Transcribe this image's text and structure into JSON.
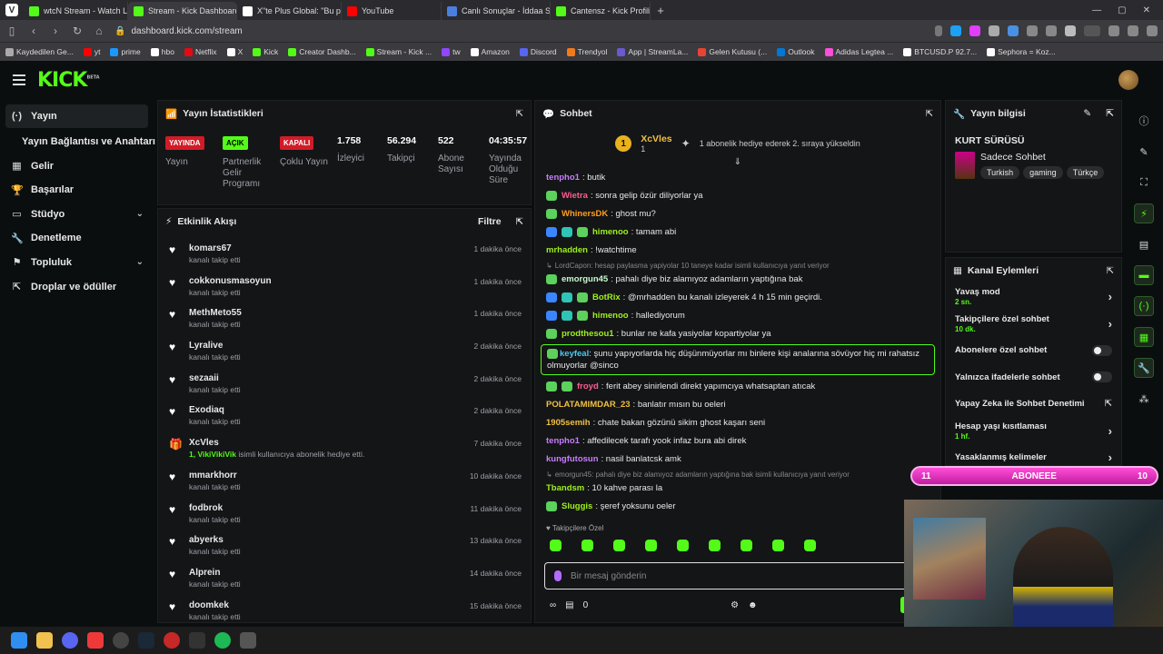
{
  "browser": {
    "tabs": [
      {
        "title": "wtcN Stream - Watch Live o",
        "color": "#53fc18"
      },
      {
        "title": "Stream - Kick Dashboard",
        "color": "#53fc18"
      },
      {
        "title": "X\"te Plus Global: \"Bu pozisy",
        "color": "#ffffff"
      },
      {
        "title": "YouTube",
        "color": "#ff0000"
      },
      {
        "title": "Canlı Sonuçlar - İddaa Son",
        "color": "#4a7fe0"
      },
      {
        "title": "Cantensz - Kick Profili",
        "color": "#53fc18"
      }
    ],
    "url": "dashboard.kick.com/stream",
    "bookmarks": [
      {
        "label": "Kaydedilen Ge...",
        "color": "#aaaaaa"
      },
      {
        "label": "yt",
        "color": "#ff0000"
      },
      {
        "label": "prime",
        "color": "#1a98ff"
      },
      {
        "label": "hbo",
        "color": "#ffffff"
      },
      {
        "label": "Netflix",
        "color": "#e50914"
      },
      {
        "label": "X",
        "color": "#ffffff"
      },
      {
        "label": "Kick",
        "color": "#53fc18"
      },
      {
        "label": "Creator Dashb...",
        "color": "#53fc18"
      },
      {
        "label": "Stream - Kick ...",
        "color": "#53fc18"
      },
      {
        "label": "tw",
        "color": "#9146ff"
      },
      {
        "label": "Amazon",
        "color": "#ffffff"
      },
      {
        "label": "Discord",
        "color": "#5865f2"
      },
      {
        "label": "Trendyol",
        "color": "#f27a1a"
      },
      {
        "label": "App | StreamLa...",
        "color": "#6a5acd"
      },
      {
        "label": "Gelen Kutusu (...",
        "color": "#ea4335"
      },
      {
        "label": "Outlook",
        "color": "#0078d4"
      },
      {
        "label": "Adidas Legtea ...",
        "color": "#ff4ed8"
      },
      {
        "label": "BTCUSD.P 92.7...",
        "color": "#ffffff"
      },
      {
        "label": "Sephora = Koz...",
        "color": "#ffffff"
      }
    ]
  },
  "sidebar": {
    "items": [
      {
        "label": "Yayın",
        "icon": "(·)"
      },
      {
        "label": "Yayın Bağlantısı ve Anahtarı",
        "icon": ""
      },
      {
        "label": "Gelir",
        "icon": "▦"
      },
      {
        "label": "Başarılar",
        "icon": "🏆"
      },
      {
        "label": "Stüdyo",
        "icon": "▭"
      },
      {
        "label": "Denetleme",
        "icon": "🔧"
      },
      {
        "label": "Topluluk",
        "icon": "⚑"
      },
      {
        "label": "Droplar ve ödüller",
        "icon": "⇱"
      }
    ]
  },
  "stats": {
    "title": "Yayın İstatistikleri",
    "items": [
      {
        "badge": "YAYINDA",
        "label": "Yayın"
      },
      {
        "badge": "AÇIK",
        "label": "Partnerlik Gelir Programı"
      },
      {
        "badge": "KAPALI",
        "label": "Çoklu Yayın"
      },
      {
        "value": "1.758",
        "label": "İzleyici"
      },
      {
        "value": "56.294",
        "label": "Takipçi"
      },
      {
        "value": "522",
        "label": "Abone Sayısı"
      },
      {
        "value": "04:35:57",
        "label": "Yayında Olduğu Süre"
      }
    ]
  },
  "events": {
    "title": "Etkinlik Akışı",
    "filter": "Filtre",
    "rows": [
      {
        "name": "komars67",
        "sub": "kanalı takip etti",
        "time": "1 dakika önce"
      },
      {
        "name": "cokkonusmasoyun",
        "sub": "kanalı takip etti",
        "time": "1 dakika önce"
      },
      {
        "name": "MethMeto55",
        "sub": "kanalı takip etti",
        "time": "1 dakika önce"
      },
      {
        "name": "Lyralive",
        "sub": "kanalı takip etti",
        "time": "2 dakika önce"
      },
      {
        "name": "sezaaii",
        "sub": "kanalı takip etti",
        "time": "2 dakika önce"
      },
      {
        "name": "Exodiaq",
        "sub": "kanalı takip etti",
        "time": "2 dakika önce"
      },
      {
        "name": "XcVles",
        "sub": "isimli kullanıcıya abonelik hediye etti.",
        "sub_strong": "1, VikiVikiVik",
        "time": "7 dakika önce",
        "gift": true
      },
      {
        "name": "mmarkhorr",
        "sub": "kanalı takip etti",
        "time": "10 dakika önce"
      },
      {
        "name": "fodbrok",
        "sub": "kanalı takip etti",
        "time": "11 dakika önce"
      },
      {
        "name": "abyerks",
        "sub": "kanalı takip etti",
        "time": "13 dakika önce"
      },
      {
        "name": "Alprein",
        "sub": "kanalı takip etti",
        "time": "14 dakika önce"
      },
      {
        "name": "doomkek",
        "sub": "kanalı takip etti",
        "time": "15 dakika önce"
      }
    ]
  },
  "chat": {
    "title": "Sohbet",
    "pinned": {
      "rank": "1",
      "name": "XcVles",
      "count": "1",
      "message": "1 abonelik hediye ederek 2. sıraya yükseldin"
    },
    "lines": [
      {
        "user": "tenpho1",
        "color": "#c77dff",
        "text": ": butik"
      },
      {
        "user": "Wietra",
        "color": "#ff5d8f",
        "text": ": sonra gelip özür diliyorlar ya",
        "emo": "g"
      },
      {
        "user": "WhinersDK",
        "color": "#ff9f1c",
        "text": ": ghost mu?",
        "emo": "g"
      },
      {
        "user": "himenoo",
        "color": "#9ef01a",
        "text": ": tamam abi",
        "emo": "bt"
      },
      {
        "user": "mrhadden",
        "color": "#9ef01a",
        "text": ": !watchtime"
      },
      {
        "reply": "LordCapon: hesap paylasma yapiyolar 10 taneye kadar isimli kullanıcıya yanıt veriyor"
      },
      {
        "user": "emorgun45",
        "color": "#c7f9cc",
        "text": ": pahalı diye biz alamıyoz adamların yaptığına bak",
        "emo": "g"
      },
      {
        "user": "BotRix",
        "color": "#9ef01a",
        "text": ": @mrhadden bu kanalı izleyerek 4 h 15 min geçirdi.",
        "emo": "bt"
      },
      {
        "user": "himenoo",
        "color": "#9ef01a",
        "text": ": hallediyorum",
        "emo": "bt"
      },
      {
        "user": "prodthesou1",
        "color": "#9ef01a",
        "text": ": bunlar ne kafa yasiyolar kopartiyolar ya",
        "emo": "g"
      },
      {
        "user": "keyfeal",
        "color": "#4cc9f0",
        "text": ": şunu yapıyorlarda hiç düşünmüyorlar mı binlere kişi anala­rına sövüyor hiç mi rahatsız olmuyorlar @sinco",
        "emo": "g",
        "highlight": true
      },
      {
        "user": "froyd",
        "color": "#ff5d8f",
        "text": ": ferit abey sinirlendi direkt yapımcıya whatsaptan atıcak",
        "emo": "gg"
      },
      {
        "user": "POLATAMIMDAR_23",
        "color": "#f0c040",
        "text": ": banlatır mısın bu oeleri"
      },
      {
        "user": "1905semih",
        "color": "#f0c040",
        "text": ": chate bakan gözünü sikim ghost kaşarı seni"
      },
      {
        "user": "tenpho1",
        "color": "#c77dff",
        "text": ": affedilecek tarafı yook infaz bura abi direk"
      },
      {
        "user": "kungfutosun",
        "color": "#c77dff",
        "text": ": nasil banlatcsk amk"
      },
      {
        "reply": "emorgun45: pahalı diye biz alamıyoz adamların yaptığına bak isimli kullanıcıya yanıt veriyor"
      },
      {
        "user": "Tbandsm",
        "color": "#9ef01a",
        "text": ": 10 kahve parası la"
      },
      {
        "user": "Sluggis",
        "color": "#9ef01a",
        "text": ": şeref yoksunu oeler",
        "emo": "g"
      }
    ],
    "followers_only": "Takipçilere Özel",
    "input_placeholder": "Bir mesaj gönderin",
    "points": "0",
    "send_label": "Gö"
  },
  "info": {
    "title": "Yayın bilgisi",
    "stream_title": "KURT SÜRÜSÜ",
    "category": "Sadece Sohbet",
    "tags": [
      "Turkish",
      "gaming",
      "Türkçe"
    ]
  },
  "actions": {
    "title": "Kanal Eylemleri",
    "rows": [
      {
        "label": "Yavaş mod",
        "value": "2 sn.",
        "type": "arrow"
      },
      {
        "label": "Takipçilere özel sohbet",
        "value": "10 dk.",
        "type": "arrow"
      },
      {
        "label": "Abonelere özel sohbet",
        "type": "toggle"
      },
      {
        "label": "Yalnızca ifadelerle sohbet",
        "type": "toggle"
      },
      {
        "label": "Yapay Zeka ile Sohbet Denetimi",
        "type": "external"
      },
      {
        "label": "Hesap yaşı kısıtlaması",
        "value": "1 hf.",
        "type": "arrow"
      },
      {
        "label": "Yasaklanmış kelimeler",
        "type": "arrow"
      }
    ]
  },
  "goal": {
    "left": "11",
    "label": "ABONEEE",
    "right": "10"
  },
  "colors": {
    "kick_green": "#53fc18",
    "live_red": "#d11c28",
    "goal_pink": "#ff4ed8"
  }
}
